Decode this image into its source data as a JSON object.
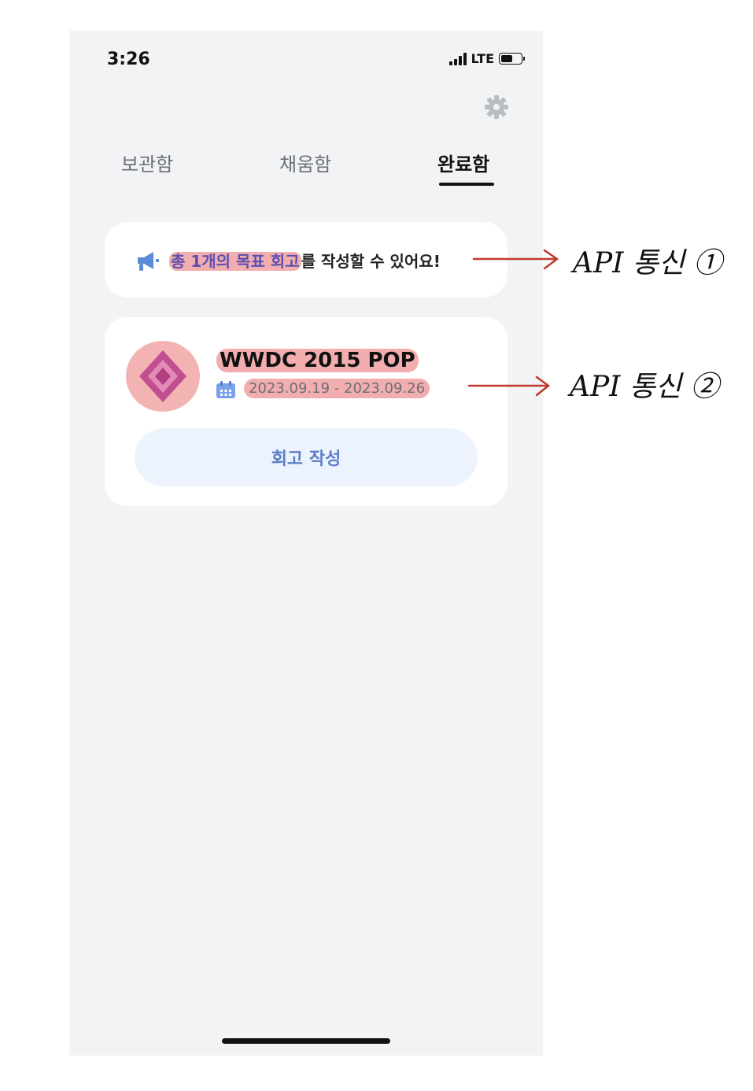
{
  "status_bar": {
    "time": "3:26",
    "network": "LTE",
    "battery_level": 0.5
  },
  "header": {
    "settings_icon": "gear-icon"
  },
  "tabs": [
    {
      "label": "보관함",
      "active": false
    },
    {
      "label": "채움함",
      "active": false
    },
    {
      "label": "완료함",
      "active": true
    }
  ],
  "notice": {
    "icon": "megaphone-icon",
    "highlight": "총 1개의 목표 회고",
    "rest": "를 작성할 수 있어요!"
  },
  "goal_card": {
    "title": "WWDC 2015 POP",
    "date_range": "2023.09.19 - 2023.09.26",
    "write_button": "회고 작성"
  },
  "annotations": [
    {
      "label": "API 통신 ①"
    },
    {
      "label": "API 통신 ②"
    }
  ],
  "colors": {
    "highlight": "#f2aeae",
    "accent_blue": "#5b7fc7",
    "button_bg": "#edf3fd",
    "annotation_arrow": "#c0392b"
  }
}
